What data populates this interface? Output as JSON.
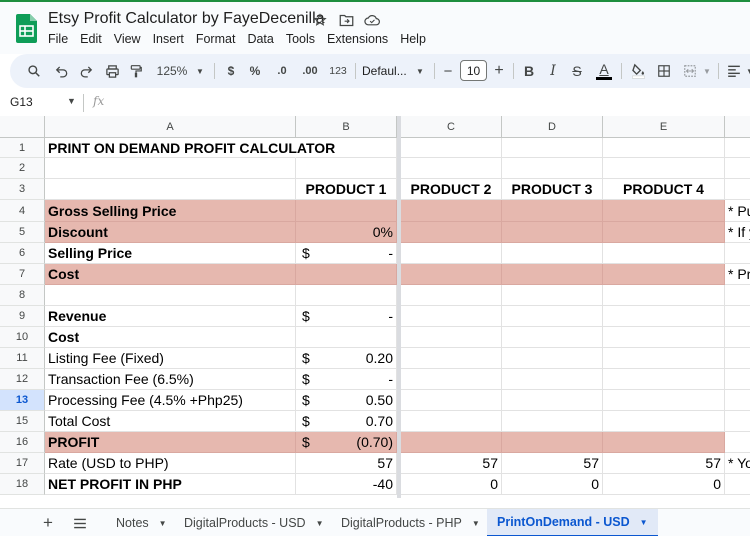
{
  "doc": {
    "title": "Etsy Profit Calculator by FayeDecenilla"
  },
  "menu": [
    "File",
    "Edit",
    "View",
    "Insert",
    "Format",
    "Data",
    "Tools",
    "Extensions",
    "Help"
  ],
  "toolbar": {
    "zoom": "125%",
    "currency": "$",
    "percent": "%",
    "decrease_decimal": ".0",
    "increase_decimal": ".00",
    "number_format": "123",
    "font": "Defaul...",
    "font_size": "10",
    "minus": "−",
    "plus": "+",
    "bold": "B",
    "italic": "I",
    "strike": "S",
    "text_color": "A"
  },
  "formula_bar": {
    "cell_ref": "G13",
    "fx": "fx"
  },
  "columns": [
    "A",
    "B",
    "C",
    "D",
    "E"
  ],
  "rows": [
    {
      "num": "1",
      "a": "PRINT ON DEMAND PROFIT CALCULATOR",
      "b_sym": "",
      "b": "",
      "c": "",
      "d": "",
      "e": "",
      "f": ""
    },
    {
      "num": "2",
      "a": "",
      "b_sym": "",
      "b": "",
      "c": "",
      "d": "",
      "e": "",
      "f": ""
    },
    {
      "num": "3",
      "a": "",
      "b_sym": "",
      "b": "PRODUCT 1",
      "c": "PRODUCT 2",
      "d": "PRODUCT 3",
      "e": "PRODUCT 4",
      "f": ""
    },
    {
      "num": "4",
      "a": "Gross Selling Price",
      "b_sym": "",
      "b": "",
      "c": "",
      "d": "",
      "e": "",
      "f": "* Pu"
    },
    {
      "num": "5",
      "a": "Discount",
      "b_sym": "",
      "b": "0%",
      "c": "",
      "d": "",
      "e": "",
      "f": "* If y"
    },
    {
      "num": "6",
      "a": "Selling Price",
      "b_sym": "$",
      "b": "-",
      "c": "",
      "d": "",
      "e": "",
      "f": ""
    },
    {
      "num": "7",
      "a": "Cost",
      "b_sym": "",
      "b": "",
      "c": "",
      "d": "",
      "e": "",
      "f": "* Pr"
    },
    {
      "num": "8",
      "a": "",
      "b_sym": "",
      "b": "",
      "c": "",
      "d": "",
      "e": "",
      "f": ""
    },
    {
      "num": "9",
      "a": "Revenue",
      "b_sym": "$",
      "b": "-",
      "c": "",
      "d": "",
      "e": "",
      "f": ""
    },
    {
      "num": "10",
      "a": "Cost",
      "b_sym": "",
      "b": "",
      "c": "",
      "d": "",
      "e": "",
      "f": ""
    },
    {
      "num": "11",
      "a": "Listing Fee (Fixed)",
      "b_sym": "$",
      "b": "0.20",
      "c": "",
      "d": "",
      "e": "",
      "f": ""
    },
    {
      "num": "12",
      "a": "Transaction Fee (6.5%)",
      "b_sym": "$",
      "b": "-",
      "c": "",
      "d": "",
      "e": "",
      "f": ""
    },
    {
      "num": "13",
      "a": "Processing Fee (4.5% +Php25)",
      "b_sym": "$",
      "b": "0.50",
      "c": "",
      "d": "",
      "e": "",
      "f": ""
    },
    {
      "num": "15",
      "a": "Total Cost",
      "b_sym": "$",
      "b": "0.70",
      "c": "",
      "d": "",
      "e": "",
      "f": ""
    },
    {
      "num": "16",
      "a": "PROFIT",
      "b_sym": "$",
      "b": "(0.70)",
      "c": "",
      "d": "",
      "e": "",
      "f": ""
    },
    {
      "num": "17",
      "a": "Rate (USD to PHP)",
      "b_sym": "",
      "b": "57",
      "c": "57",
      "d": "57",
      "e": "57",
      "f": "* Yo"
    },
    {
      "num": "18",
      "a": "NET PROFIT IN PHP",
      "b_sym": "",
      "b": "-40",
      "c": "0",
      "d": "0",
      "e": "0",
      "f": ""
    }
  ],
  "sheet_tabs": [
    "Notes",
    "DigitalProducts - USD",
    "DigitalProducts - PHP",
    "PrintOnDemand - USD"
  ],
  "active_tab": "PrintOnDemand - USD",
  "colors": {
    "pink_fill": "#e6b8af",
    "accent_blue": "#0b57d0",
    "sheets_green": "#0f9d58"
  }
}
